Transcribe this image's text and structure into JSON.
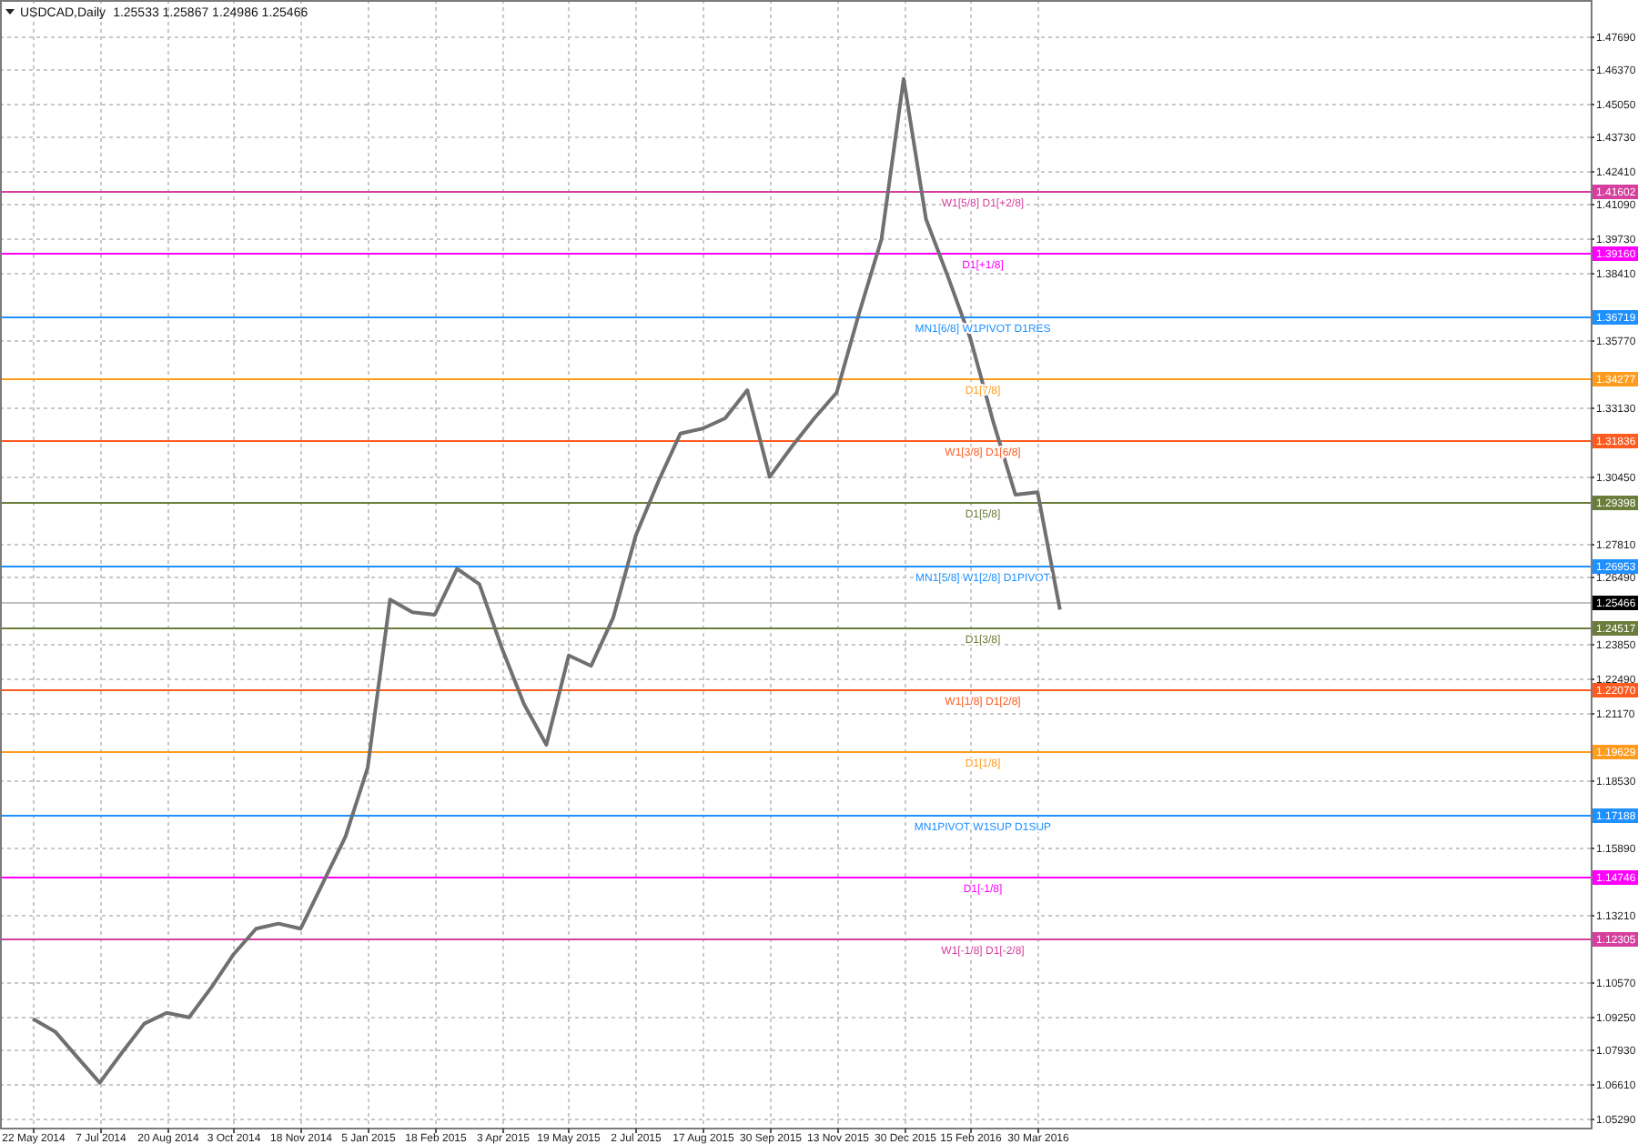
{
  "chart": {
    "symbol": "USDCAD,Daily",
    "ohlc": "1.25533 1.25867 1.24986 1.25466",
    "chart_data": {
      "type": "line",
      "grid": true,
      "ylim": [
        1.049,
        1.4909
      ],
      "categories": [
        "22 May 2014",
        null,
        null,
        "7 Jul 2014",
        null,
        null,
        "20 Aug 2014",
        null,
        null,
        "3 Oct 2014",
        null,
        null,
        "18 Nov 2014",
        null,
        null,
        "5 Jan 2015",
        null,
        null,
        "18 Feb 2015",
        null,
        null,
        "3 Apr 2015",
        null,
        null,
        "19 May 2015",
        null,
        null,
        "2 Jul 2015",
        null,
        null,
        "17 Aug 2015",
        null,
        null,
        "30 Sep 2015",
        null,
        null,
        "13 Nov 2015",
        null,
        null,
        "30 Dec 2015",
        null,
        null,
        "15 Feb 2016",
        null,
        null,
        "30 Mar 2016",
        null
      ],
      "yticks": [
        {
          "value": 1.4769,
          "label": "1.47690"
        },
        {
          "value": 1.4637,
          "label": "1.46370"
        },
        {
          "value": 1.4505,
          "label": "1.45050"
        },
        {
          "value": 1.4373,
          "label": "1.43730"
        },
        {
          "value": 1.4241,
          "label": "1.42410"
        },
        {
          "value": 1.4109,
          "label": "1.41090"
        },
        {
          "value": 1.3973,
          "label": "1.39730"
        },
        {
          "value": 1.3841,
          "label": "1.38410"
        },
        {
          "value": 1.3577,
          "label": "1.35770"
        },
        {
          "value": 1.3313,
          "label": "1.33130"
        },
        {
          "value": 1.3045,
          "label": "1.30450"
        },
        {
          "value": 1.2781,
          "label": "1.27810"
        },
        {
          "value": 1.2649,
          "label": "1.26490"
        },
        {
          "value": 1.2385,
          "label": "1.23850"
        },
        {
          "value": 1.2249,
          "label": "1.22490"
        },
        {
          "value": 1.2117,
          "label": "1.21170"
        },
        {
          "value": 1.1853,
          "label": "1.18530"
        },
        {
          "value": 1.1589,
          "label": "1.15890"
        },
        {
          "value": 1.1321,
          "label": "1.13210"
        },
        {
          "value": 1.1057,
          "label": "1.10570"
        },
        {
          "value": 1.0925,
          "label": "1.09250"
        },
        {
          "value": 1.0793,
          "label": "1.07930"
        },
        {
          "value": 1.0661,
          "label": "1.06610"
        },
        {
          "value": 1.0529,
          "label": "1.05290"
        }
      ],
      "series": [
        {
          "color": "#707070",
          "values": [
            1.0917,
            1.0866,
            1.0766,
            1.0666,
            1.0785,
            1.0898,
            1.094,
            1.0922,
            1.104,
            1.117,
            1.127,
            1.129,
            1.127,
            1.145,
            1.163,
            1.19,
            1.256,
            1.251,
            1.25,
            1.268,
            1.262,
            1.237,
            1.215,
            1.199,
            1.234,
            1.23,
            1.249,
            1.281,
            1.302,
            1.321,
            1.323,
            1.327,
            1.338,
            1.304,
            1.316,
            1.327,
            1.337,
            1.368,
            1.397,
            1.46,
            1.405,
            1.382,
            1.358,
            1.326,
            1.297,
            1.298,
            1.252
          ]
        }
      ],
      "ref_lines": [
        {
          "axis": "y",
          "value": 1.41602,
          "label": "W1[5/8] D1[+2/8]",
          "color": "#d63f9e"
        },
        {
          "axis": "y",
          "value": 1.3916,
          "label": "D1[+1/8]",
          "color": "#ff00ff"
        },
        {
          "axis": "y",
          "value": 1.36719,
          "label": "MN1[6/8] W1PIVOT D1RES",
          "color": "#1e90ff"
        },
        {
          "axis": "y",
          "value": 1.34277,
          "label": "D1[7/8]",
          "color": "#ff9c1e"
        },
        {
          "axis": "y",
          "value": 1.31836,
          "label": "W1[3/8] D1[6/8]",
          "color": "#ff5a1f"
        },
        {
          "axis": "y",
          "value": 1.29398,
          "label": "D1[5/8]",
          "color": "#6b7d3a"
        },
        {
          "axis": "y",
          "value": 1.26953,
          "label": "MN1[5/8] W1[2/8] D1PIVOT",
          "color": "#1e90ff"
        },
        {
          "axis": "y",
          "value": 1.24517,
          "label": "D1[3/8]",
          "color": "#6b7d3a"
        },
        {
          "axis": "y",
          "value": 1.2207,
          "label": "W1[1/8] D1[2/8]",
          "color": "#ff5a1f"
        },
        {
          "axis": "y",
          "value": 1.19629,
          "label": "D1[1/8]",
          "color": "#ff9c1e"
        },
        {
          "axis": "y",
          "value": 1.17188,
          "label": "MN1PIVOT W1SUP D1SUP",
          "color": "#1e90ff"
        },
        {
          "axis": "y",
          "value": 1.14746,
          "label": "D1[-1/8]",
          "color": "#ff00ff"
        },
        {
          "axis": "y",
          "value": 1.12305,
          "label": "W1[-1/8] D1[-2/8]",
          "color": "#d63f9e"
        },
        {
          "axis": "y",
          "value": 1.25466,
          "color": "#c0c0c0"
        }
      ]
    },
    "price_tags": [
      "1.41602",
      "1.39160",
      "1.36719",
      "1.34277",
      "1.31836",
      "1.29398",
      "1.26953",
      "1.24517",
      "1.22070",
      "1.19629",
      "1.17188",
      "1.14746",
      "1.12305"
    ],
    "current_price": "1.25466"
  }
}
